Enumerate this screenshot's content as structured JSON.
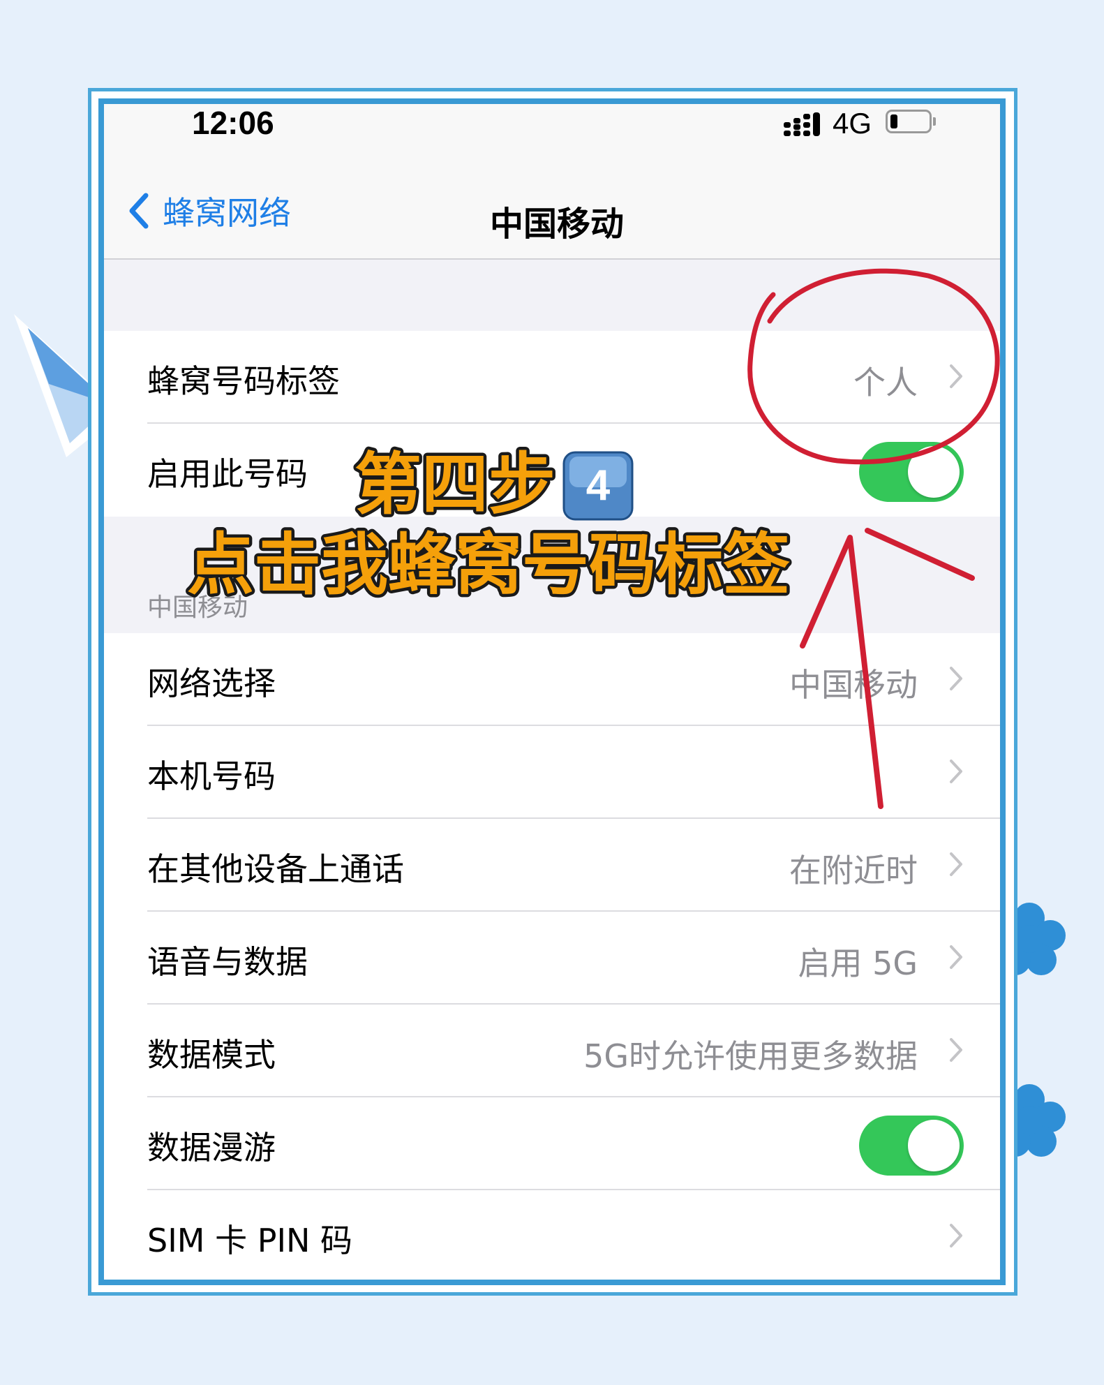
{
  "status_bar": {
    "time": "12:06",
    "network": "4G"
  },
  "nav": {
    "back_label": "蜂窝网络",
    "title": "中国移动"
  },
  "group1": {
    "rows": [
      {
        "label": "蜂窝号码标签",
        "value": "个人"
      },
      {
        "label": "启用此号码",
        "toggle_on": true
      }
    ]
  },
  "section_header": "中国移动",
  "group2": {
    "rows": [
      {
        "label": "网络选择",
        "value": "中国移动"
      },
      {
        "label": "本机号码",
        "value": ""
      },
      {
        "label": "在其他设备上通话",
        "value": "在附近时"
      },
      {
        "label": "语音与数据",
        "value": "启用 5G"
      },
      {
        "label": "数据模式",
        "value": "5G时允许使用更多数据"
      },
      {
        "label": "数据漫游",
        "toggle_on": true
      },
      {
        "label": "SIM 卡 PIN 码",
        "value": ""
      }
    ]
  },
  "overlay": {
    "step_title": "第四步",
    "step_badge": "4",
    "instruction": "点击我蜂窝号码标签"
  },
  "colors": {
    "accent_blue": "#1f7fe6",
    "toggle_green": "#34c759",
    "annotation_red": "#d01f33",
    "overlay_text_orange": "#f5a00a"
  }
}
